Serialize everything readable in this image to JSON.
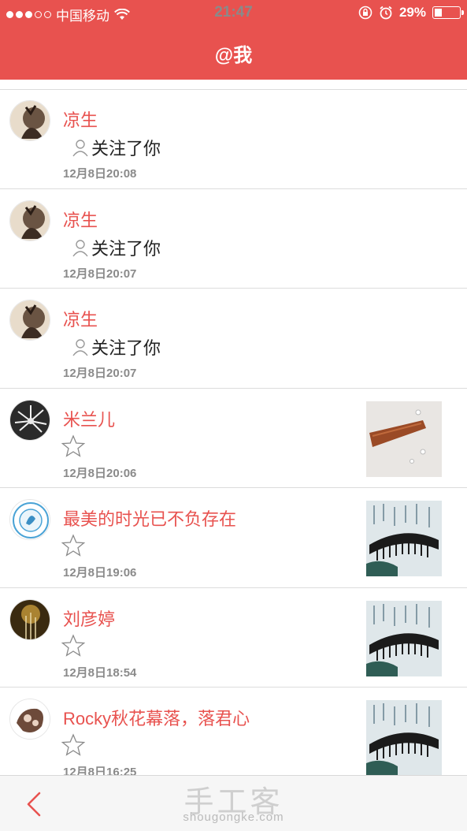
{
  "status_bar": {
    "carrier": "中国移动",
    "time": "21:47",
    "battery": "29%",
    "battery_level": 0.29
  },
  "header": {
    "title": "@我"
  },
  "notifications": [
    {
      "name": "凉生",
      "type": "follow",
      "action": "关注了你",
      "time": "12月8日20:08"
    },
    {
      "name": "凉生",
      "type": "follow",
      "action": "关注了你",
      "time": "12月8日20:07"
    },
    {
      "name": "凉生",
      "type": "follow",
      "action": "关注了你",
      "time": "12月8日20:07"
    },
    {
      "name": "米兰儿",
      "type": "favorite",
      "action": "",
      "time": "12月8日20:06"
    },
    {
      "name": "最美的时光已不负存在",
      "type": "favorite",
      "action": "",
      "time": "12月8日19:06"
    },
    {
      "name": "刘彦婷",
      "type": "favorite",
      "action": "",
      "time": "12月8日18:54"
    },
    {
      "name": "Rocky秋花幕落，落君心",
      "type": "favorite",
      "action": "",
      "time": "12月8日16:25"
    }
  ],
  "footer": {
    "back_icon": "chevron-left-icon",
    "watermark_title": "手工客",
    "watermark_url": "shougongke.com"
  },
  "colors": {
    "accent": "#e8524f",
    "name_text": "#e8524f",
    "time_text": "#8a8a8a",
    "divider": "#dcdcdc"
  }
}
